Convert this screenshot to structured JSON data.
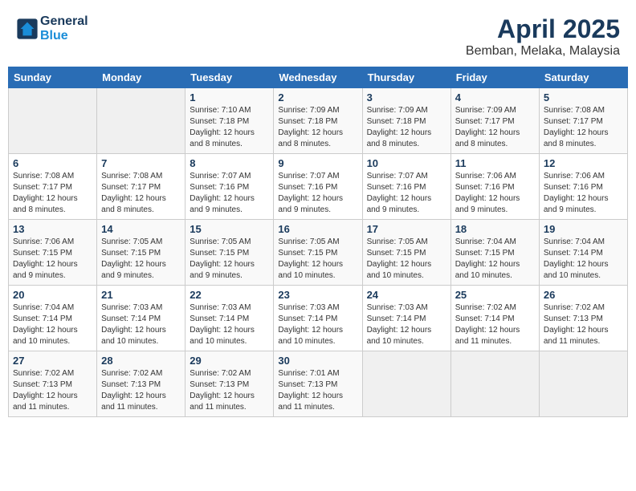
{
  "header": {
    "logo_line1": "General",
    "logo_line2": "Blue",
    "title": "April 2025",
    "subtitle": "Bemban, Melaka, Malaysia"
  },
  "weekdays": [
    "Sunday",
    "Monday",
    "Tuesday",
    "Wednesday",
    "Thursday",
    "Friday",
    "Saturday"
  ],
  "weeks": [
    [
      {
        "day": "",
        "sunrise": "",
        "sunset": "",
        "daylight": ""
      },
      {
        "day": "",
        "sunrise": "",
        "sunset": "",
        "daylight": ""
      },
      {
        "day": "1",
        "sunrise": "Sunrise: 7:10 AM",
        "sunset": "Sunset: 7:18 PM",
        "daylight": "Daylight: 12 hours and 8 minutes."
      },
      {
        "day": "2",
        "sunrise": "Sunrise: 7:09 AM",
        "sunset": "Sunset: 7:18 PM",
        "daylight": "Daylight: 12 hours and 8 minutes."
      },
      {
        "day": "3",
        "sunrise": "Sunrise: 7:09 AM",
        "sunset": "Sunset: 7:18 PM",
        "daylight": "Daylight: 12 hours and 8 minutes."
      },
      {
        "day": "4",
        "sunrise": "Sunrise: 7:09 AM",
        "sunset": "Sunset: 7:17 PM",
        "daylight": "Daylight: 12 hours and 8 minutes."
      },
      {
        "day": "5",
        "sunrise": "Sunrise: 7:08 AM",
        "sunset": "Sunset: 7:17 PM",
        "daylight": "Daylight: 12 hours and 8 minutes."
      }
    ],
    [
      {
        "day": "6",
        "sunrise": "Sunrise: 7:08 AM",
        "sunset": "Sunset: 7:17 PM",
        "daylight": "Daylight: 12 hours and 8 minutes."
      },
      {
        "day": "7",
        "sunrise": "Sunrise: 7:08 AM",
        "sunset": "Sunset: 7:17 PM",
        "daylight": "Daylight: 12 hours and 8 minutes."
      },
      {
        "day": "8",
        "sunrise": "Sunrise: 7:07 AM",
        "sunset": "Sunset: 7:16 PM",
        "daylight": "Daylight: 12 hours and 9 minutes."
      },
      {
        "day": "9",
        "sunrise": "Sunrise: 7:07 AM",
        "sunset": "Sunset: 7:16 PM",
        "daylight": "Daylight: 12 hours and 9 minutes."
      },
      {
        "day": "10",
        "sunrise": "Sunrise: 7:07 AM",
        "sunset": "Sunset: 7:16 PM",
        "daylight": "Daylight: 12 hours and 9 minutes."
      },
      {
        "day": "11",
        "sunrise": "Sunrise: 7:06 AM",
        "sunset": "Sunset: 7:16 PM",
        "daylight": "Daylight: 12 hours and 9 minutes."
      },
      {
        "day": "12",
        "sunrise": "Sunrise: 7:06 AM",
        "sunset": "Sunset: 7:16 PM",
        "daylight": "Daylight: 12 hours and 9 minutes."
      }
    ],
    [
      {
        "day": "13",
        "sunrise": "Sunrise: 7:06 AM",
        "sunset": "Sunset: 7:15 PM",
        "daylight": "Daylight: 12 hours and 9 minutes."
      },
      {
        "day": "14",
        "sunrise": "Sunrise: 7:05 AM",
        "sunset": "Sunset: 7:15 PM",
        "daylight": "Daylight: 12 hours and 9 minutes."
      },
      {
        "day": "15",
        "sunrise": "Sunrise: 7:05 AM",
        "sunset": "Sunset: 7:15 PM",
        "daylight": "Daylight: 12 hours and 9 minutes."
      },
      {
        "day": "16",
        "sunrise": "Sunrise: 7:05 AM",
        "sunset": "Sunset: 7:15 PM",
        "daylight": "Daylight: 12 hours and 10 minutes."
      },
      {
        "day": "17",
        "sunrise": "Sunrise: 7:05 AM",
        "sunset": "Sunset: 7:15 PM",
        "daylight": "Daylight: 12 hours and 10 minutes."
      },
      {
        "day": "18",
        "sunrise": "Sunrise: 7:04 AM",
        "sunset": "Sunset: 7:15 PM",
        "daylight": "Daylight: 12 hours and 10 minutes."
      },
      {
        "day": "19",
        "sunrise": "Sunrise: 7:04 AM",
        "sunset": "Sunset: 7:14 PM",
        "daylight": "Daylight: 12 hours and 10 minutes."
      }
    ],
    [
      {
        "day": "20",
        "sunrise": "Sunrise: 7:04 AM",
        "sunset": "Sunset: 7:14 PM",
        "daylight": "Daylight: 12 hours and 10 minutes."
      },
      {
        "day": "21",
        "sunrise": "Sunrise: 7:03 AM",
        "sunset": "Sunset: 7:14 PM",
        "daylight": "Daylight: 12 hours and 10 minutes."
      },
      {
        "day": "22",
        "sunrise": "Sunrise: 7:03 AM",
        "sunset": "Sunset: 7:14 PM",
        "daylight": "Daylight: 12 hours and 10 minutes."
      },
      {
        "day": "23",
        "sunrise": "Sunrise: 7:03 AM",
        "sunset": "Sunset: 7:14 PM",
        "daylight": "Daylight: 12 hours and 10 minutes."
      },
      {
        "day": "24",
        "sunrise": "Sunrise: 7:03 AM",
        "sunset": "Sunset: 7:14 PM",
        "daylight": "Daylight: 12 hours and 10 minutes."
      },
      {
        "day": "25",
        "sunrise": "Sunrise: 7:02 AM",
        "sunset": "Sunset: 7:14 PM",
        "daylight": "Daylight: 12 hours and 11 minutes."
      },
      {
        "day": "26",
        "sunrise": "Sunrise: 7:02 AM",
        "sunset": "Sunset: 7:13 PM",
        "daylight": "Daylight: 12 hours and 11 minutes."
      }
    ],
    [
      {
        "day": "27",
        "sunrise": "Sunrise: 7:02 AM",
        "sunset": "Sunset: 7:13 PM",
        "daylight": "Daylight: 12 hours and 11 minutes."
      },
      {
        "day": "28",
        "sunrise": "Sunrise: 7:02 AM",
        "sunset": "Sunset: 7:13 PM",
        "daylight": "Daylight: 12 hours and 11 minutes."
      },
      {
        "day": "29",
        "sunrise": "Sunrise: 7:02 AM",
        "sunset": "Sunset: 7:13 PM",
        "daylight": "Daylight: 12 hours and 11 minutes."
      },
      {
        "day": "30",
        "sunrise": "Sunrise: 7:01 AM",
        "sunset": "Sunset: 7:13 PM",
        "daylight": "Daylight: 12 hours and 11 minutes."
      },
      {
        "day": "",
        "sunrise": "",
        "sunset": "",
        "daylight": ""
      },
      {
        "day": "",
        "sunrise": "",
        "sunset": "",
        "daylight": ""
      },
      {
        "day": "",
        "sunrise": "",
        "sunset": "",
        "daylight": ""
      }
    ]
  ]
}
